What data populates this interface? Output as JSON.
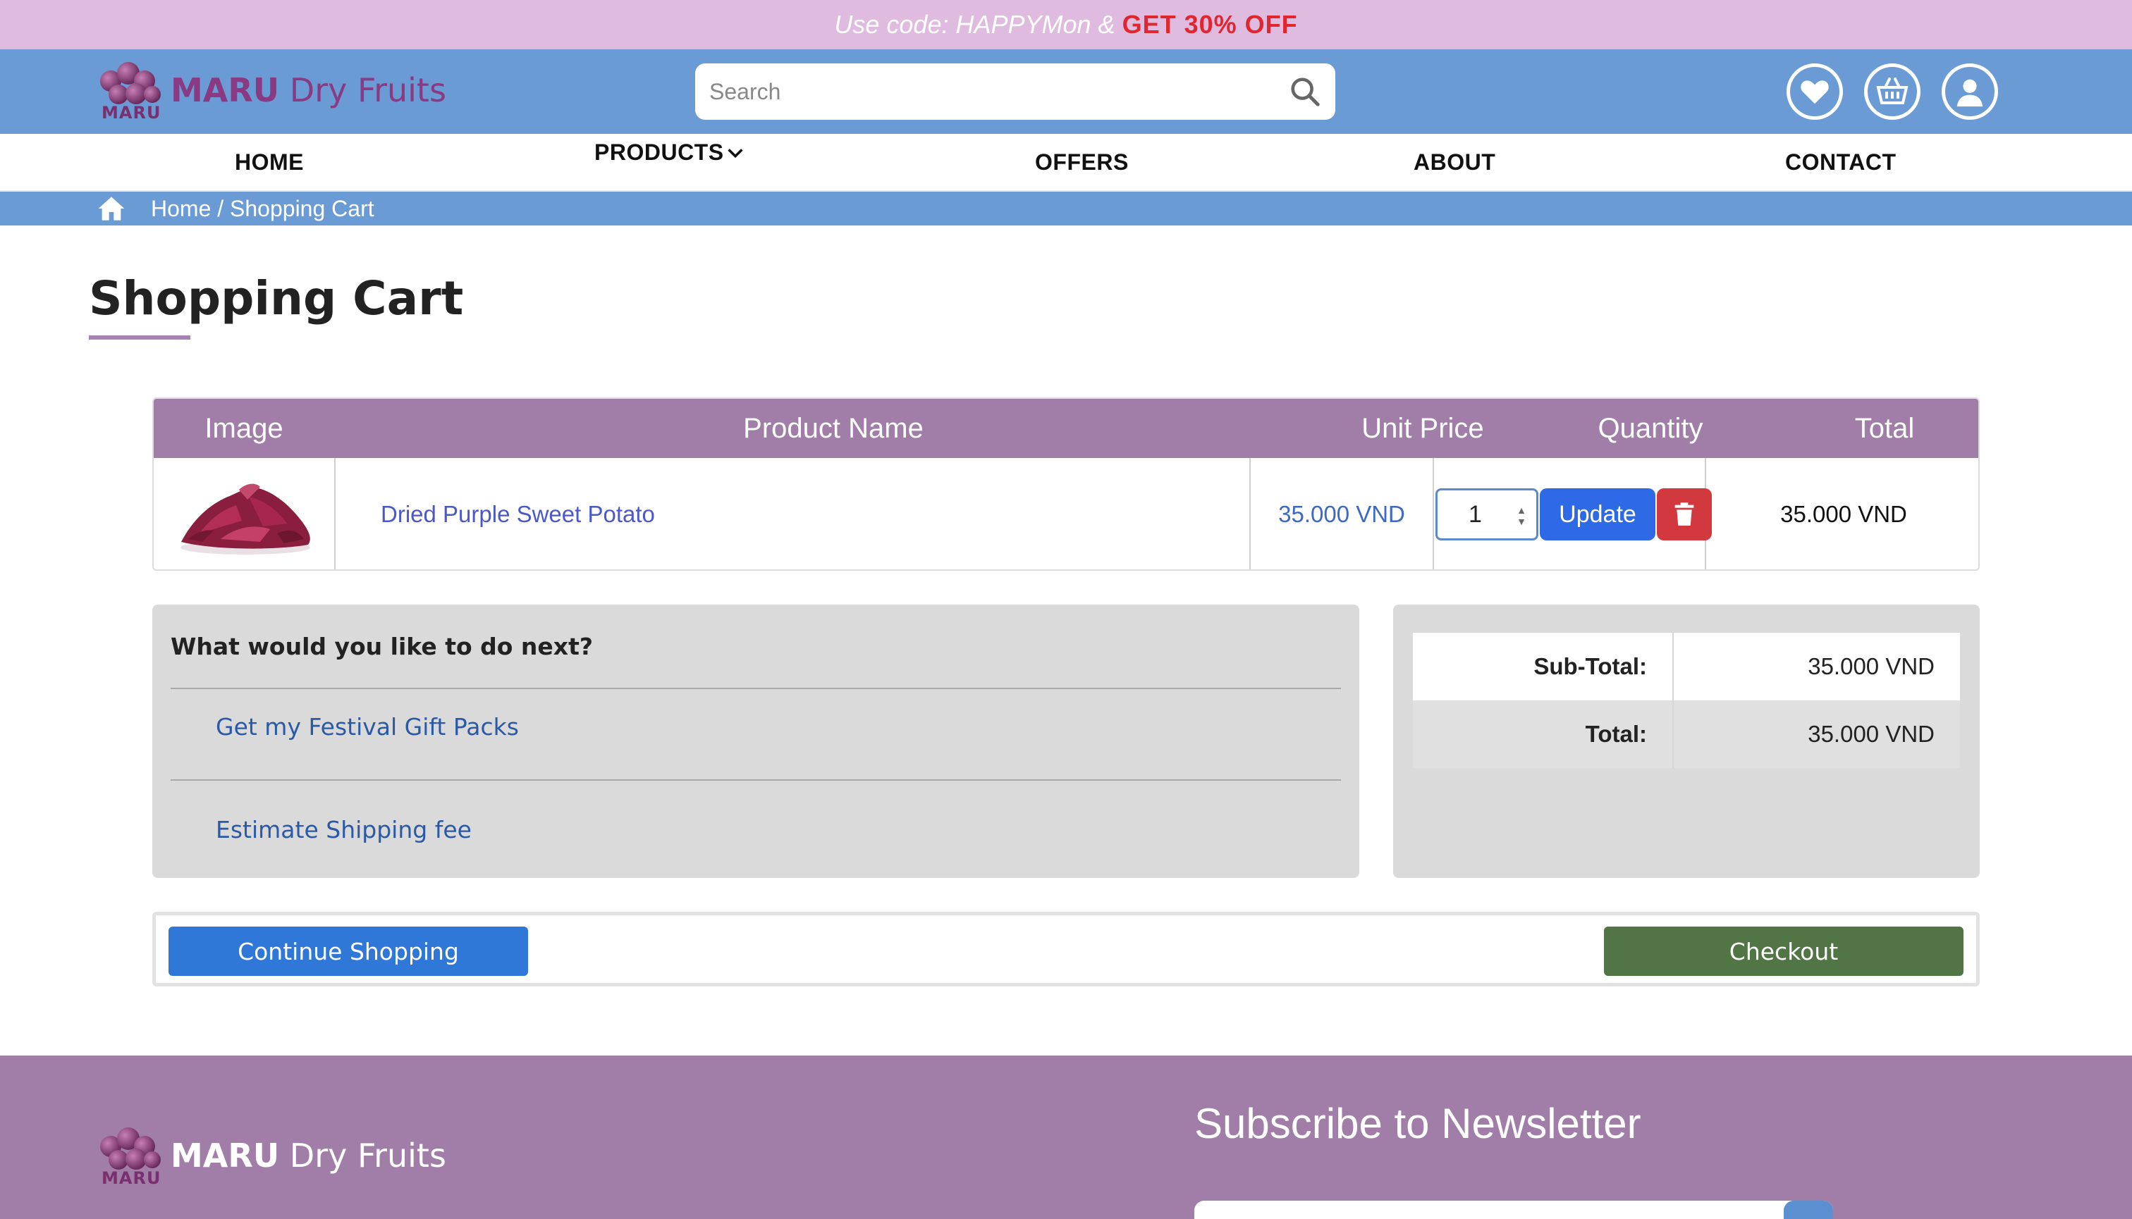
{
  "promo": {
    "code_text": "Use code: HAPPYMon &",
    "deal_text": "GET  30%  OFF"
  },
  "brand": {
    "name_bold": "MARU",
    "name_rest": " Dry Fruits",
    "logo_sub": "MARU"
  },
  "header": {
    "search_placeholder": "Search",
    "icons": [
      "heart-icon",
      "basket-icon",
      "user-icon"
    ]
  },
  "nav": {
    "items": [
      {
        "label": "HOME"
      },
      {
        "label": "PRODUCTS"
      },
      {
        "label": "OFFERS"
      },
      {
        "label": "ABOUT"
      },
      {
        "label": "CONTACT"
      }
    ]
  },
  "breadcrumb": {
    "text": "Home / Shopping Cart"
  },
  "page": {
    "title": "Shopping Cart"
  },
  "cart": {
    "columns": [
      "Image",
      "Product Name",
      "Unit Price",
      "Quantity",
      "Total"
    ],
    "rows": [
      {
        "product_name": "Dried Purple Sweet Potato",
        "unit_price": "35.000 VND",
        "quantity": "1",
        "update_label": "Update",
        "total": "35.000 VND"
      }
    ]
  },
  "next_steps": {
    "title": "What would you like to do next?",
    "links": [
      "Get my Festival Gift Packs",
      "Estimate Shipping fee"
    ]
  },
  "totals": {
    "subtotal_label": "Sub-Total:",
    "subtotal_value": "35.000 VND",
    "total_label": "Total:",
    "total_value": "35.000 VND"
  },
  "actions": {
    "continue_label": "Continue Shopping",
    "checkout_label": "Checkout"
  },
  "footer": {
    "newsletter_title": "Subscribe to Newsletter"
  },
  "colors": {
    "promo_bg": "#dfbcdf",
    "header_blue": "#6b9bd4",
    "table_header": "#a17ea7",
    "update_blue": "#2e6ae6",
    "delete_red": "#d1393f",
    "checkout_green": "#527546",
    "continue_blue": "#2f78d8"
  }
}
